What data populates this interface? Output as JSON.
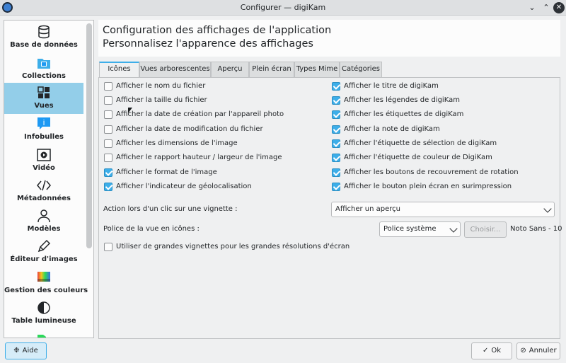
{
  "window": {
    "title": "Configurer — digiKam"
  },
  "sidebar": {
    "items": [
      {
        "label": "Base de données"
      },
      {
        "label": "Collections"
      },
      {
        "label": "Vues"
      },
      {
        "label": "Infobulles"
      },
      {
        "label": "Vidéo"
      },
      {
        "label": "Métadonnées"
      },
      {
        "label": "Modèles"
      },
      {
        "label": "Éditeur d'images"
      },
      {
        "label": "Gestion des couleurs"
      },
      {
        "label": "Table lumineuse"
      }
    ]
  },
  "header": {
    "title": "Configuration des affichages de l'application",
    "subtitle": "Personnalisez l'apparence des affichages"
  },
  "tabs": [
    {
      "label": "Icônes"
    },
    {
      "label": "Vues arborescentes"
    },
    {
      "label": "Aperçu"
    },
    {
      "label": "Plein écran"
    },
    {
      "label": "Types Mime"
    },
    {
      "label": "Catégories"
    }
  ],
  "left_checks": [
    {
      "label": "Afficher le nom du fichier",
      "checked": false
    },
    {
      "label": "Afficher la taille du fichier",
      "checked": false
    },
    {
      "label": "Afficher la date de création par l'appareil photo",
      "checked": false
    },
    {
      "label": "Afficher la date de modification du fichier",
      "checked": false
    },
    {
      "label": "Afficher les dimensions de l'image",
      "checked": false
    },
    {
      "label": "Afficher le rapport hauteur / largeur de l'image",
      "checked": false
    },
    {
      "label": "Afficher le format de l'image",
      "checked": true
    },
    {
      "label": "Afficher l'indicateur de géolocalisation",
      "checked": true
    }
  ],
  "right_checks": [
    {
      "label": "Afficher le titre de digiKam",
      "checked": true
    },
    {
      "label": "Afficher les légendes de digiKam",
      "checked": true
    },
    {
      "label": "Afficher les étiquettes de digiKam",
      "checked": true
    },
    {
      "label": "Afficher la note de digiKam",
      "checked": true
    },
    {
      "label": "Afficher l'étiquette de sélection de digiKam",
      "checked": true
    },
    {
      "label": "Afficher l'étiquette de couleur de DigiKam",
      "checked": true
    },
    {
      "label": "Afficher les boutons de recouvrement de rotation",
      "checked": true
    },
    {
      "label": "Afficher le bouton plein écran en surimpression",
      "checked": true
    }
  ],
  "click_action": {
    "label": "Action lors d'un clic sur une vignette :",
    "value": "Afficher un aperçu"
  },
  "font": {
    "label": "Police de la vue en icônes :",
    "value": "Police système",
    "choose_label": "Choisir...",
    "current": "Noto Sans - 10"
  },
  "large_thumbs": {
    "label": "Utiliser de grandes vignettes pour les grandes résolutions d'écran",
    "checked": false
  },
  "footer": {
    "help_label": "Aide",
    "ok_label": "Ok",
    "cancel_label": "Annuler"
  },
  "colors": {
    "accent": "#3daee9",
    "selection": "#93cee9"
  }
}
